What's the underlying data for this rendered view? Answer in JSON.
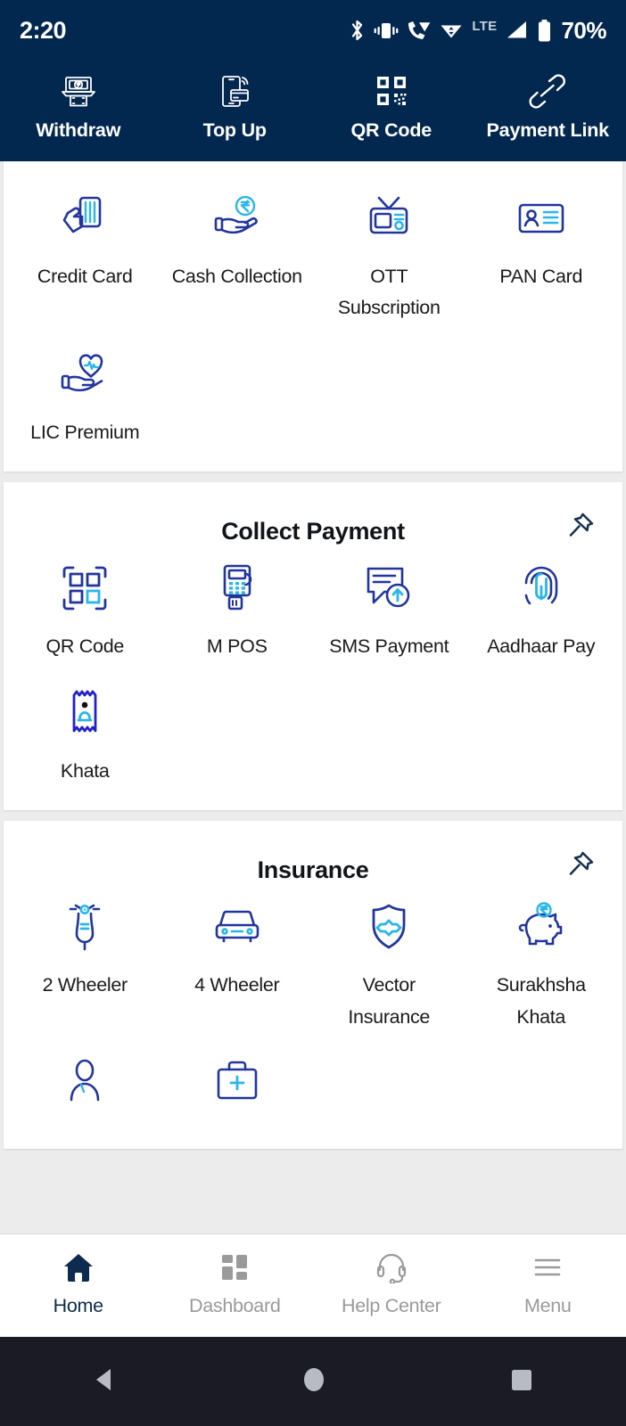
{
  "status_bar": {
    "time": "2:20",
    "battery_percent": "70%",
    "network_type": "LTE",
    "icons": [
      "bluetooth-icon",
      "vibrate-icon",
      "wifi-calling-icon",
      "wifi-icon",
      "cellular-signal-icon",
      "battery-icon"
    ]
  },
  "header_actions": [
    {
      "label": "Withdraw",
      "icon": "atm-withdraw-icon"
    },
    {
      "label": "Top Up",
      "icon": "phone-nfc-topup-icon"
    },
    {
      "label": "QR Code",
      "icon": "qr-code-icon"
    },
    {
      "label": "Payment Link",
      "icon": "link-chain-icon"
    }
  ],
  "sections": [
    {
      "title": "",
      "has_pin": false,
      "items": [
        {
          "label": "Credit Card",
          "icon": "hand-credit-card-icon"
        },
        {
          "label": "Cash Collection",
          "icon": "hand-rupee-coin-icon"
        },
        {
          "label": "OTT Subscription",
          "icon": "television-icon"
        },
        {
          "label": "PAN Card",
          "icon": "id-card-icon"
        },
        {
          "label": "LIC Premium",
          "icon": "hand-heart-pulse-icon"
        }
      ]
    },
    {
      "title": "Collect Payment",
      "has_pin": true,
      "pin_icon": "pushpin-icon",
      "items": [
        {
          "label": "QR Code",
          "icon": "qr-scan-icon"
        },
        {
          "label": "M POS",
          "icon": "pos-terminal-icon"
        },
        {
          "label": "SMS Payment",
          "icon": "sms-upload-icon"
        },
        {
          "label": "Aadhaar Pay",
          "icon": "fingerprint-icon"
        },
        {
          "label": "Khata",
          "icon": "receipt-person-icon"
        }
      ]
    },
    {
      "title": "Insurance",
      "has_pin": true,
      "pin_icon": "pushpin-icon",
      "items": [
        {
          "label": "2 Wheeler",
          "icon": "scooter-icon"
        },
        {
          "label": "4 Wheeler",
          "icon": "car-icon"
        },
        {
          "label": "Vector Insurance",
          "icon": "shield-plus-icon"
        },
        {
          "label": "Surakhsha Khata",
          "icon": "piggy-bank-rupee-icon"
        },
        {
          "label": "",
          "icon": "person-icon"
        },
        {
          "label": "",
          "icon": "medical-briefcase-icon"
        }
      ]
    }
  ],
  "bottom_nav": [
    {
      "label": "Home",
      "icon": "home-icon",
      "active": true
    },
    {
      "label": "Dashboard",
      "icon": "dashboard-grid-icon",
      "active": false
    },
    {
      "label": "Help Center",
      "icon": "headset-icon",
      "active": false
    },
    {
      "label": "Menu",
      "icon": "hamburger-menu-icon",
      "active": false
    }
  ],
  "system_nav": [
    {
      "icon": "back-triangle-icon"
    },
    {
      "icon": "home-circle-icon"
    },
    {
      "icon": "recents-square-icon"
    }
  ],
  "colors": {
    "header_navy": "#032850",
    "icon_navy": "#22359c",
    "icon_cyan": "#29b6e8",
    "page_bg": "#ececec",
    "card_bg": "#ffffff",
    "text_dark": "#1a1a1a",
    "nav_inactive": "#9a9a9a"
  }
}
